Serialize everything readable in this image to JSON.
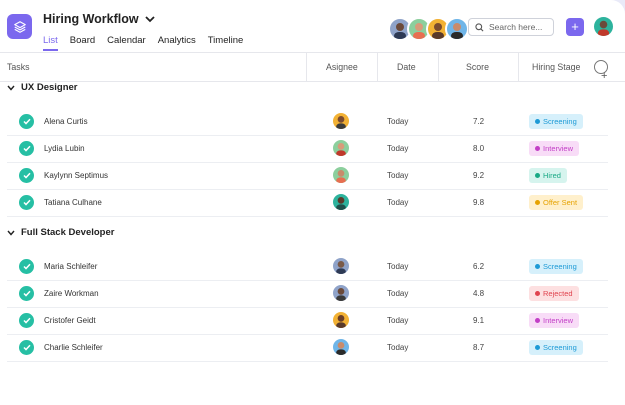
{
  "header": {
    "title": "Hiring Workflow",
    "tabs": [
      {
        "label": "List",
        "active": true
      },
      {
        "label": "Board",
        "active": false
      },
      {
        "label": "Calendar",
        "active": false
      },
      {
        "label": "Analytics",
        "active": false
      },
      {
        "label": "Timeline",
        "active": false
      }
    ],
    "search_placeholder": "Search here...",
    "add_icon": "plus"
  },
  "columns": {
    "tasks": "Tasks",
    "assignee": "Asignee",
    "date": "Date",
    "score": "Score",
    "stage": "Hiring Stage"
  },
  "groups": [
    {
      "title": "UX Designer",
      "rows": [
        {
          "name": "Alena Curtis",
          "date": "Today",
          "score": "7.2",
          "stage": "Screening"
        },
        {
          "name": "Lydia Lubin",
          "date": "Today",
          "score": "8.0",
          "stage": "Interview"
        },
        {
          "name": "Kaylynn Septimus",
          "date": "Today",
          "score": "9.2",
          "stage": "Hired"
        },
        {
          "name": "Tatiana Culhane",
          "date": "Today",
          "score": "9.8",
          "stage": "Offer Sent"
        }
      ]
    },
    {
      "title": "Full Stack Developer",
      "rows": [
        {
          "name": "Maria Schleifer",
          "date": "Today",
          "score": "6.2",
          "stage": "Screening"
        },
        {
          "name": "Zaire Workman",
          "date": "Today",
          "score": "4.8",
          "stage": "Rejected"
        },
        {
          "name": "Cristofer Geidt",
          "date": "Today",
          "score": "9.1",
          "stage": "Interview"
        },
        {
          "name": "Charlie Schleifer",
          "date": "Today",
          "score": "8.7",
          "stage": "Screening"
        }
      ]
    }
  ],
  "colors": {
    "accent": "#7b68ee",
    "check": "#26bfa4",
    "Screening": {
      "bg": "#d6f0fb",
      "fg": "#1d9ad6"
    },
    "Interview": {
      "bg": "#f8dcf7",
      "fg": "#c23ec6"
    },
    "Hired": {
      "bg": "#d6f4ee",
      "fg": "#19a985"
    },
    "Offer Sent": {
      "bg": "#fff0cc",
      "fg": "#e6a200"
    },
    "Rejected": {
      "bg": "#fde0e1",
      "fg": "#e0434e"
    }
  }
}
